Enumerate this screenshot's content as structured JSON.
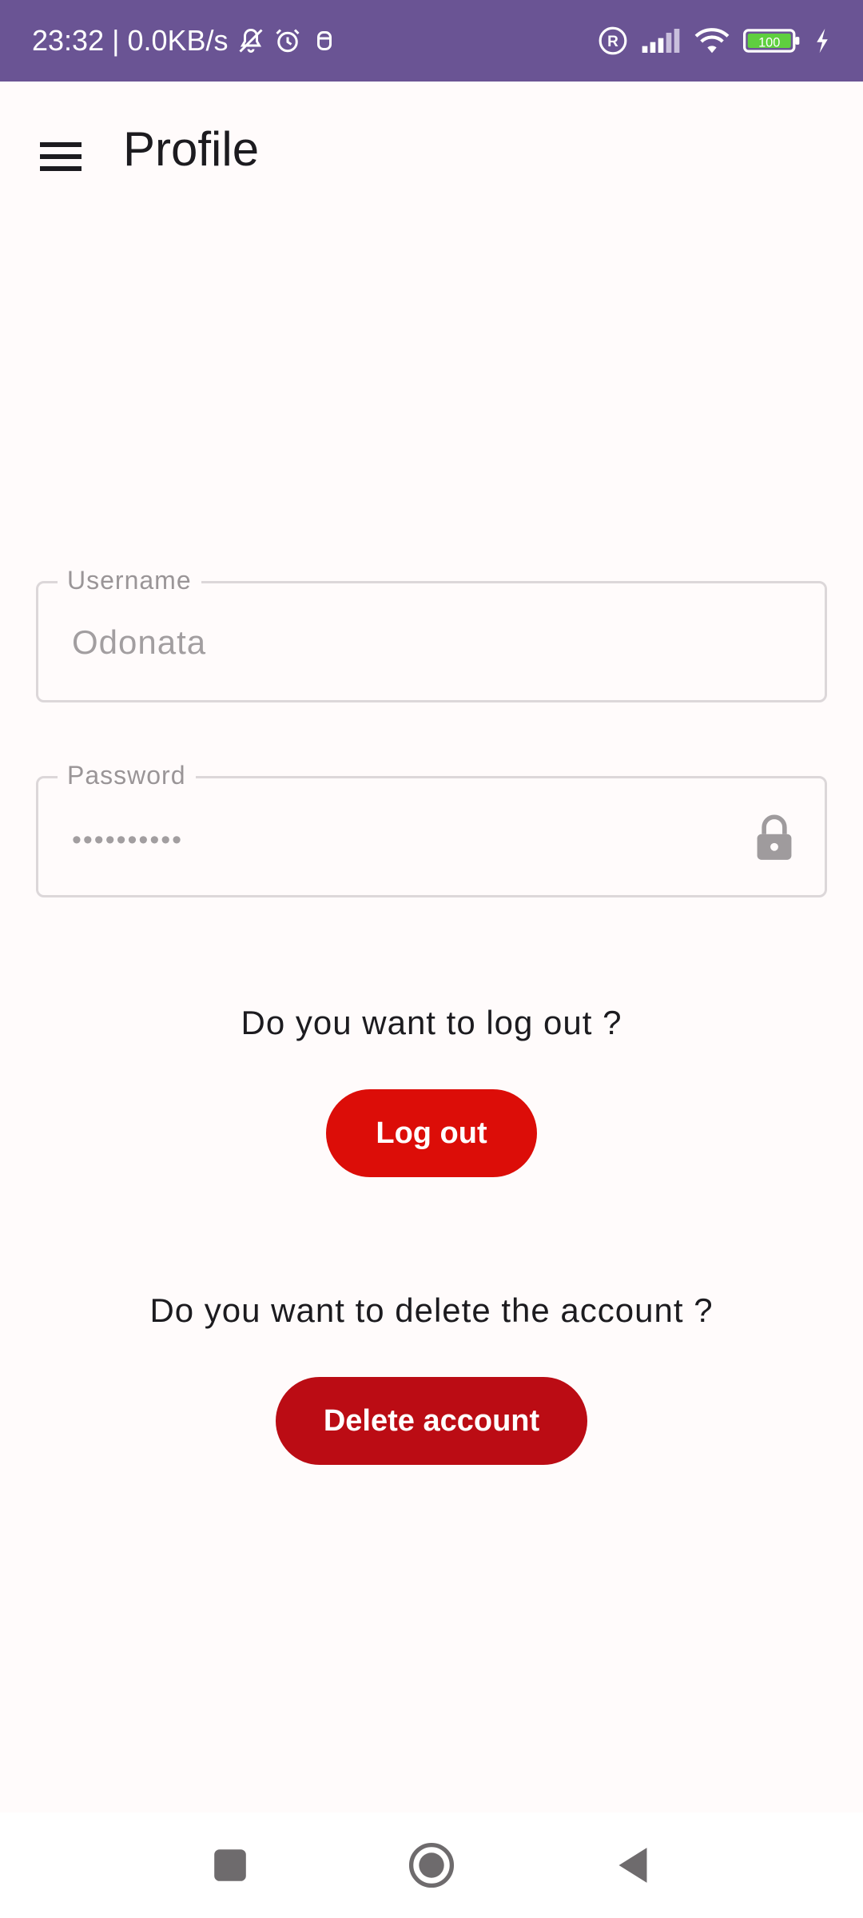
{
  "status_bar": {
    "time_speed": "23:32 | 0.0KB/s",
    "battery": "100",
    "icons": [
      "bell-off-icon",
      "alarm-icon",
      "notification-icon",
      "registered-icon",
      "signal-icon",
      "wifi-icon",
      "battery-icon",
      "charging-icon"
    ]
  },
  "app_bar": {
    "title": "Profile",
    "menu_icon": "menu-icon"
  },
  "form": {
    "username_label": "Username",
    "username_value": "Odonata",
    "password_label": "Password",
    "password_value": "••••••••••",
    "password_icon": "lock-icon"
  },
  "logout": {
    "question": "Do you want to log out ?",
    "button_label": "Log out"
  },
  "delete": {
    "question": "Do you want to delete the account ?",
    "button_label": "Delete account"
  },
  "colors": {
    "status_bar": "#6a5494",
    "logout_button": "#dc0d08",
    "delete_button": "#bb0c14",
    "background": "#fffbfb"
  },
  "nav_bar": {
    "icons": [
      "recents-square-icon",
      "home-circle-icon",
      "back-triangle-icon"
    ]
  }
}
